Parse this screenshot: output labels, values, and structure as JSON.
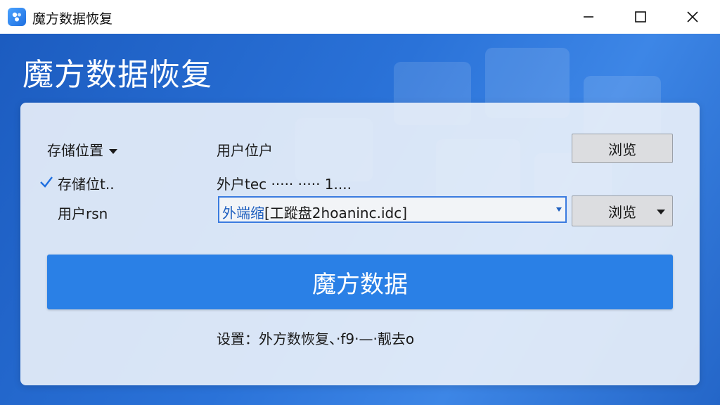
{
  "window": {
    "title": "魔方数据恢复",
    "controls": {
      "minimize": "minimize-icon",
      "maximize": "maximize-icon",
      "close": "close-icon"
    }
  },
  "header": {
    "heading": "魔方数据恢复"
  },
  "form": {
    "row1": {
      "label": "存储位置",
      "value": "用户位户",
      "button": "浏览"
    },
    "row2": {
      "label": "存储位t..",
      "value": "外户tec ····· ····· 1....",
      "checked": true
    },
    "row3": {
      "label": "用户rsn",
      "path_prefix": "外端缩",
      "path_rest": "[工蹤盘2hoaninc.idc]",
      "button": "浏览"
    }
  },
  "primary_button": "魔方数据",
  "status_text": "设置：外方数恢复、·f9·—·靓去o",
  "colors": {
    "accent": "#2a80e6",
    "titlebar": "#ffffff",
    "background": "#1f63c6"
  }
}
